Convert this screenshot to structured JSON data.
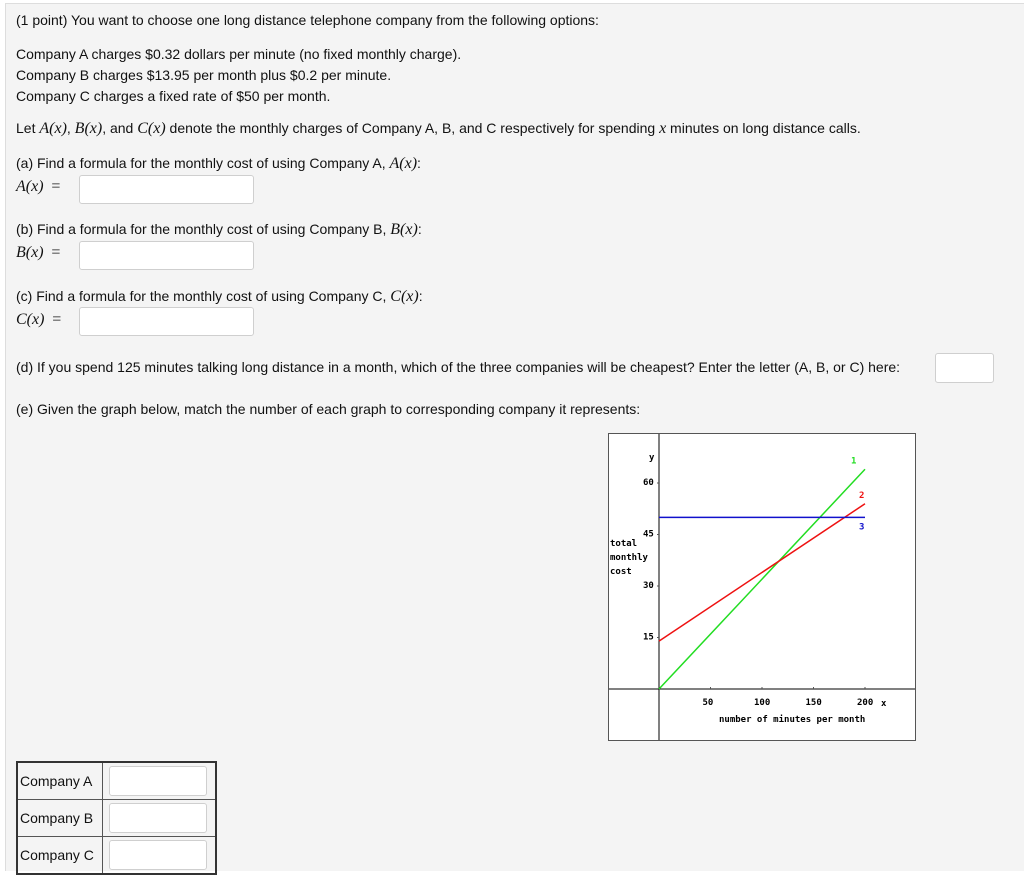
{
  "intro": "(1 point) You want to choose one long distance telephone company from the following options:",
  "companies": [
    "Company A charges $0.32 dollars per minute (no fixed monthly charge).",
    "Company B charges $13.95 per month plus $0.2 per minute.",
    "Company C charges a fixed rate of $50 per month."
  ],
  "let_text": {
    "pre": "Let ",
    "a": "A(x)",
    "sep1": ", ",
    "b": "B(x)",
    "sep2": ", and ",
    "c": "C(x)",
    "mid": " denote the monthly charges of Company A, B, and C respectively for spending ",
    "x": "x",
    "post": " minutes on long distance calls."
  },
  "parts": {
    "a": {
      "question": "(a) Find a formula for the monthly cost of using Company A, ",
      "fn": "A(x)",
      "colon": ":",
      "label": "A(x)",
      "eq": "=",
      "value": ""
    },
    "b": {
      "question": "(b) Find a formula for the monthly cost of using Company B, ",
      "fn": "B(x)",
      "colon": ":",
      "label": "B(x)",
      "eq": "=",
      "value": ""
    },
    "c": {
      "question": "(c) Find a formula for the monthly cost of using Company C, ",
      "fn": "C(x)",
      "colon": ":",
      "label": "C(x)",
      "eq": "=",
      "value": ""
    },
    "d": {
      "question": "(d) If you spend 125 minutes talking long distance in a month, which of the three companies will be cheapest? Enter the letter (A, B, or C) here:",
      "value": ""
    },
    "e": {
      "question": "(e) Given the graph below, match the number of each graph to corresponding company it represents:"
    }
  },
  "match_table": [
    {
      "label": "Company A",
      "value": ""
    },
    {
      "label": "Company B",
      "value": ""
    },
    {
      "label": "Company C",
      "value": ""
    }
  ],
  "chart_data": {
    "type": "line",
    "xlabel": "number of minutes per month",
    "ylabel": "total monthly cost",
    "x_axis_name": "x",
    "y_axis_name": "y",
    "xlim": [
      0,
      200
    ],
    "ylim": [
      0,
      65
    ],
    "x_ticks": [
      50,
      100,
      150,
      200
    ],
    "y_ticks": [
      15,
      30,
      45,
      60
    ],
    "grid": false,
    "series": [
      {
        "name": "1",
        "color": "#22dd22",
        "x": [
          0,
          200
        ],
        "y": [
          0,
          64
        ]
      },
      {
        "name": "2",
        "color": "#ee1111",
        "x": [
          0,
          200
        ],
        "y": [
          13.95,
          53.95
        ]
      },
      {
        "name": "3",
        "color": "#1111cc",
        "x": [
          0,
          200
        ],
        "y": [
          50,
          50
        ]
      }
    ]
  }
}
